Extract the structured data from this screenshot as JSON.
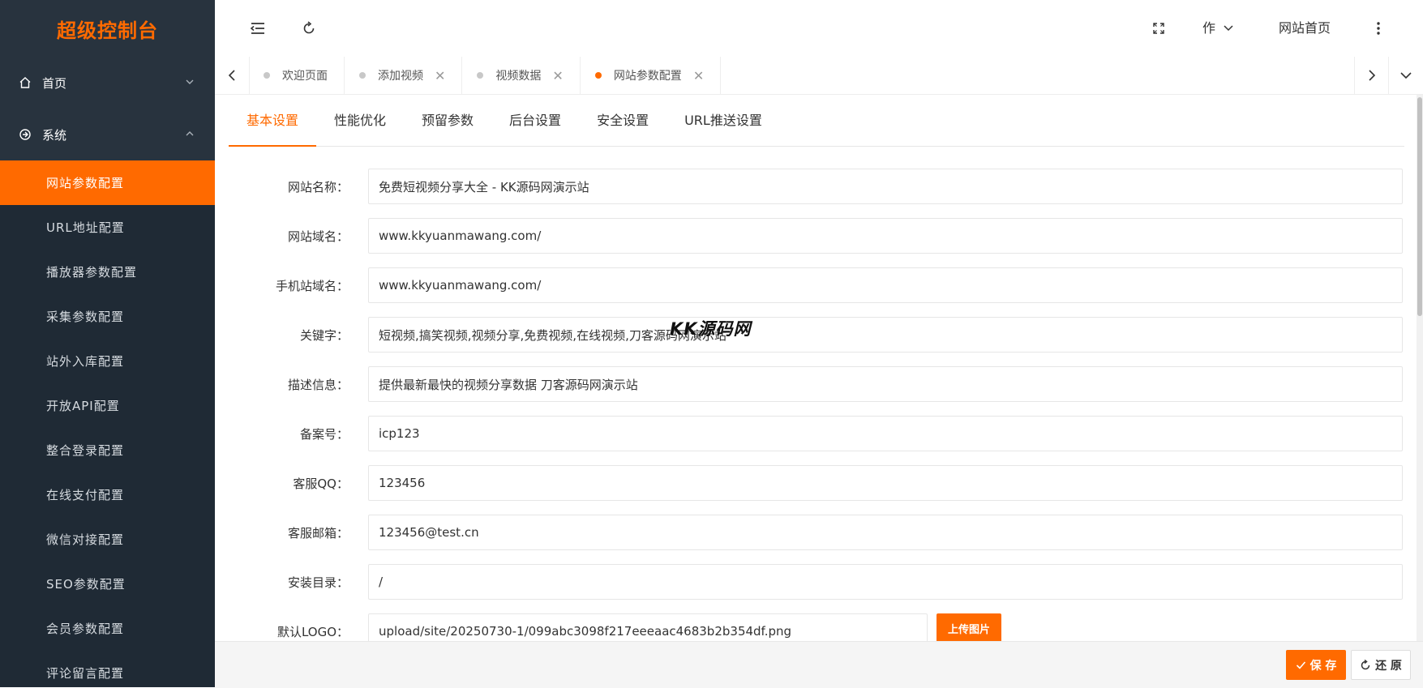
{
  "sidebar": {
    "logo": "超级控制台",
    "groups": [
      {
        "label": "首页",
        "icon": "home-icon",
        "expanded": false
      },
      {
        "label": "系统",
        "icon": "system-icon",
        "expanded": true
      }
    ],
    "items": [
      {
        "label": "网站参数配置",
        "active": true
      },
      {
        "label": "URL地址配置"
      },
      {
        "label": "播放器参数配置"
      },
      {
        "label": "采集参数配置"
      },
      {
        "label": "站外入库配置"
      },
      {
        "label": "开放API配置"
      },
      {
        "label": "整合登录配置"
      },
      {
        "label": "在线支付配置"
      },
      {
        "label": "微信对接配置"
      },
      {
        "label": "SEO参数配置"
      },
      {
        "label": "会员参数配置"
      },
      {
        "label": "评论留言配置"
      }
    ]
  },
  "header": {
    "user_label": "作",
    "home_link": "网站首页"
  },
  "tabs": [
    {
      "label": "欢迎页面",
      "closable": false,
      "active": false
    },
    {
      "label": "添加视频",
      "closable": true,
      "active": false
    },
    {
      "label": "视频数据",
      "closable": true,
      "active": false
    },
    {
      "label": "网站参数配置",
      "closable": true,
      "active": true
    }
  ],
  "subtabs": [
    "基本设置",
    "性能优化",
    "预留参数",
    "后台设置",
    "安全设置",
    "URL推送设置"
  ],
  "form": {
    "fields": [
      {
        "label": "网站名称：",
        "value": "免费短视频分享大全 - KK源码网演示站"
      },
      {
        "label": "网站域名：",
        "value": "www.kkyuanmawang.com/"
      },
      {
        "label": "手机站域名：",
        "value": "www.kkyuanmawang.com/"
      },
      {
        "label": "关键字：",
        "value": "短视频,搞笑视频,视频分享,免费视频,在线视频,刀客源码网演示站"
      },
      {
        "label": "描述信息：",
        "value": "提供最新最快的视频分享数据 刀客源码网演示站"
      },
      {
        "label": "备案号：",
        "value": "icp123"
      },
      {
        "label": "客服QQ：",
        "value": "123456"
      },
      {
        "label": "客服邮箱：",
        "value": "123456@test.cn"
      },
      {
        "label": "安装目录：",
        "value": "/"
      },
      {
        "label": "默认LOGO：",
        "value": "upload/site/20250730-1/099abc3098f217eeeaac4683b2b354df.png"
      }
    ],
    "upload_label": "上传图片"
  },
  "footer": {
    "save_label": "保 存",
    "reset_label": "还 原"
  },
  "watermark": "KK源码网",
  "colors": {
    "accent": "#ff6a00",
    "sidebar_bg": "#28333e",
    "submenu_bg": "#1f2a35"
  }
}
